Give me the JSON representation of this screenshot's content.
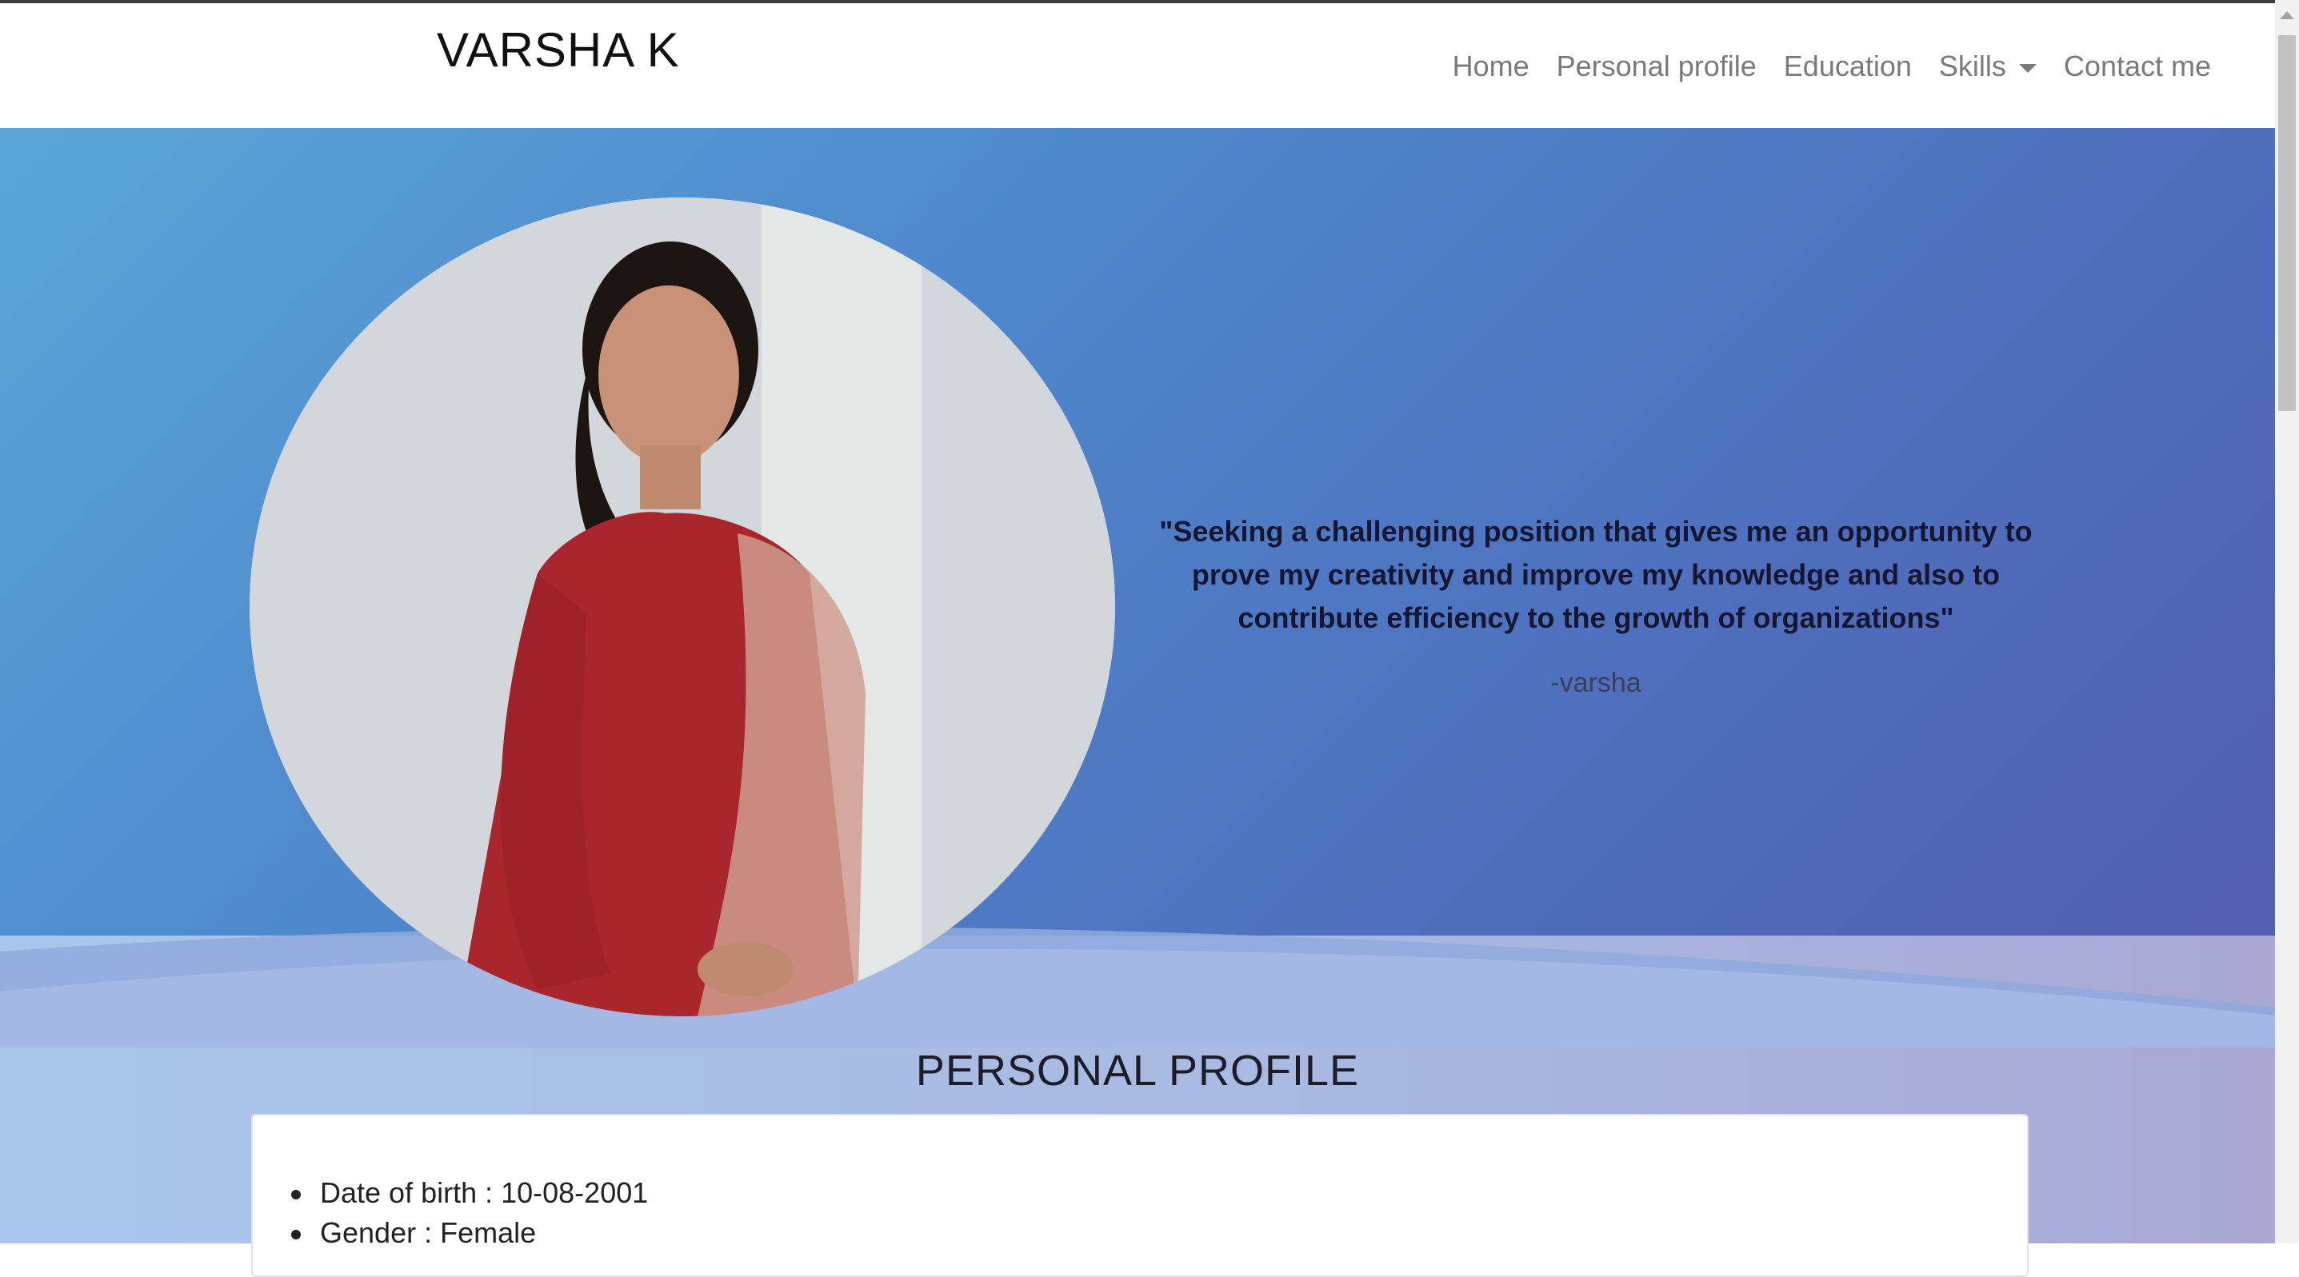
{
  "navbar": {
    "brand": "VARSHA K",
    "links": [
      "Home",
      "Personal profile",
      "Education",
      "Skills",
      "Contact me"
    ]
  },
  "hero": {
    "quote": "\"Seeking a challenging position that gives me an opportunity to prove my creativity and improve my knowledge and also to contribute efficiency to the growth of organizations\"",
    "author": "-varsha"
  },
  "profile": {
    "title": "PERSONAL PROFILE",
    "items": [
      "Date of birth : 10-08-2001",
      "Gender : Female"
    ]
  },
  "colors": {
    "hero_start": "#5aa6d6",
    "hero_end": "#5358a8",
    "nav_link": "#7a7a7a"
  }
}
